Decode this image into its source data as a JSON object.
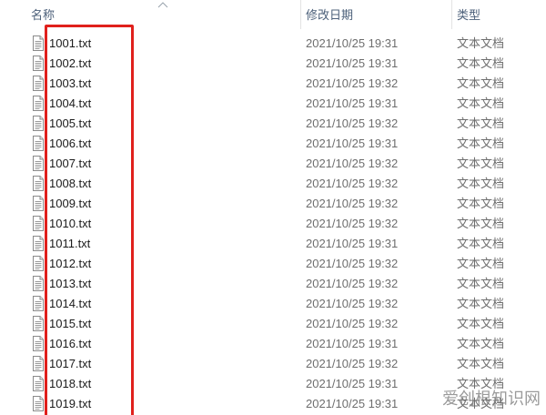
{
  "header": {
    "name_label": "名称",
    "date_label": "修改日期",
    "type_label": "类型"
  },
  "files": [
    {
      "name": "1001.txt",
      "date": "2021/10/25 19:31",
      "type": "文本文档"
    },
    {
      "name": "1002.txt",
      "date": "2021/10/25 19:31",
      "type": "文本文档"
    },
    {
      "name": "1003.txt",
      "date": "2021/10/25 19:32",
      "type": "文本文档"
    },
    {
      "name": "1004.txt",
      "date": "2021/10/25 19:31",
      "type": "文本文档"
    },
    {
      "name": "1005.txt",
      "date": "2021/10/25 19:32",
      "type": "文本文档"
    },
    {
      "name": "1006.txt",
      "date": "2021/10/25 19:31",
      "type": "文本文档"
    },
    {
      "name": "1007.txt",
      "date": "2021/10/25 19:32",
      "type": "文本文档"
    },
    {
      "name": "1008.txt",
      "date": "2021/10/25 19:32",
      "type": "文本文档"
    },
    {
      "name": "1009.txt",
      "date": "2021/10/25 19:32",
      "type": "文本文档"
    },
    {
      "name": "1010.txt",
      "date": "2021/10/25 19:32",
      "type": "文本文档"
    },
    {
      "name": "1011.txt",
      "date": "2021/10/25 19:31",
      "type": "文本文档"
    },
    {
      "name": "1012.txt",
      "date": "2021/10/25 19:32",
      "type": "文本文档"
    },
    {
      "name": "1013.txt",
      "date": "2021/10/25 19:32",
      "type": "文本文档"
    },
    {
      "name": "1014.txt",
      "date": "2021/10/25 19:32",
      "type": "文本文档"
    },
    {
      "name": "1015.txt",
      "date": "2021/10/25 19:32",
      "type": "文本文档"
    },
    {
      "name": "1016.txt",
      "date": "2021/10/25 19:31",
      "type": "文本文档"
    },
    {
      "name": "1017.txt",
      "date": "2021/10/25 19:32",
      "type": "文本文档"
    },
    {
      "name": "1018.txt",
      "date": "2021/10/25 19:31",
      "type": "文本文档"
    },
    {
      "name": "1019.txt",
      "date": "2021/10/25 19:31",
      "type": "文本文档"
    }
  ],
  "icons": {
    "file_icon": "text-file-icon",
    "sort_icon": "sort-ascending-icon"
  },
  "colors": {
    "highlight": "#e0201c",
    "header_text": "#4c607a"
  },
  "watermark": "爱创根知识网"
}
